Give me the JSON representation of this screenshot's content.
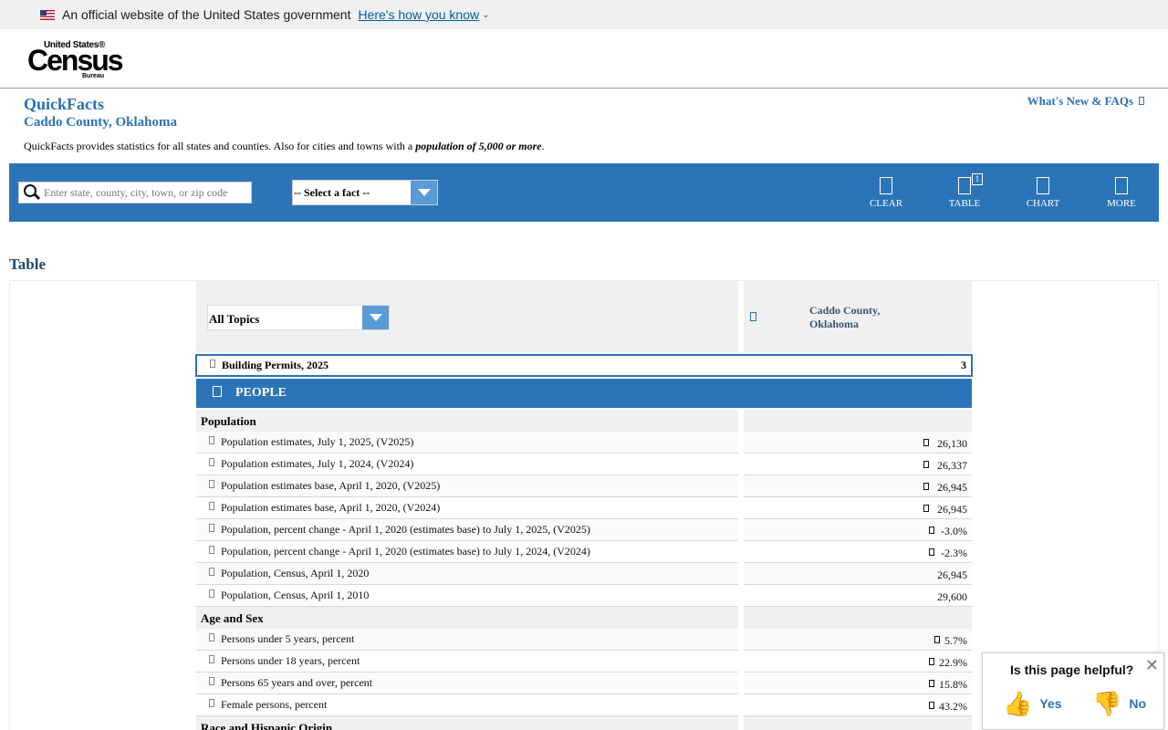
{
  "gov_banner": {
    "text": "An official website of the United States government",
    "link": "Here's how you know"
  },
  "logo": {
    "line1": "United States®",
    "line2": "Census",
    "line3": "Bureau"
  },
  "page": {
    "title": "QuickFacts",
    "geography": "Caddo County, Oklahoma",
    "description_prefix": "QuickFacts provides statistics for all states and counties. Also for cities and towns with a ",
    "description_emph": "population of 5,000 or more",
    "description_suffix": ".",
    "whats_new": "What's New & FAQs"
  },
  "toolbar": {
    "search_placeholder": "Enter state, county, city, town, or zip code",
    "fact_select": "-- Select a fact --",
    "clear": "CLEAR",
    "table": "TABLE",
    "table_badge": "1",
    "chart": "CHART",
    "more": "MORE"
  },
  "table": {
    "heading": "Table",
    "topic_select": "All Topics",
    "column": "Caddo County, Oklahoma",
    "permits": {
      "label": "Building Permits, 2025",
      "value": "3"
    },
    "people_section": "PEOPLE",
    "population_group": "Population",
    "population_rows": [
      {
        "label": "Population estimates, July 1, 2025, (V2025)",
        "value": "26,130",
        "flag": true
      },
      {
        "label": "Population estimates, July 1, 2024, (V2024)",
        "value": "26,337",
        "flag": true
      },
      {
        "label": "Population estimates base, April 1, 2020, (V2025)",
        "value": "26,945",
        "flag": true
      },
      {
        "label": "Population estimates base, April 1, 2020, (V2024)",
        "value": "26,945",
        "flag": true
      },
      {
        "label": "Population, percent change - April 1, 2020 (estimates base) to July 1, 2025, (V2025)",
        "value": "-3.0%",
        "flag": true
      },
      {
        "label": "Population, percent change - April 1, 2020 (estimates base) to July 1, 2024, (V2024)",
        "value": "-2.3%",
        "flag": true
      },
      {
        "label": "Population, Census, April 1, 2020",
        "value": "26,945",
        "flag": false
      },
      {
        "label": "Population, Census, April 1, 2010",
        "value": "29,600",
        "flag": false
      }
    ],
    "age_group": "Age and Sex",
    "age_rows": [
      {
        "label": "Persons under 5 years, percent",
        "value": "5.7%",
        "flag": true
      },
      {
        "label": "Persons under 18 years, percent",
        "value": "22.9%",
        "flag": true
      },
      {
        "label": "Persons 65 years and over, percent",
        "value": "15.8%",
        "flag": true
      },
      {
        "label": "Female persons, percent",
        "value": "43.2%",
        "flag": true
      }
    ],
    "race_group": "Race and Hispanic Origin"
  },
  "feedback": {
    "question": "Is this page helpful?",
    "yes": "Yes",
    "no": "No"
  }
}
